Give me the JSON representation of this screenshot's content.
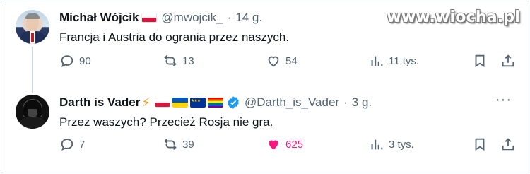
{
  "watermark": "www.wiocha.pl",
  "tweets": [
    {
      "name": "Michał Wójcik",
      "handle": "@mwojcik_",
      "separator": "·",
      "time": "14 g.",
      "text": "Francja i Austria do ograniа przez naszych.",
      "stats": {
        "replies": "90",
        "retweets": "13",
        "likes": "54",
        "views": "11 tys."
      },
      "liked": false
    },
    {
      "name": "Darth is Vader",
      "handle": "@Darth_is_Vader",
      "separator": "·",
      "time": "3 g.",
      "text": "Przez waszych? Przecież Rosja nie gra.",
      "stats": {
        "replies": "7",
        "retweets": "39",
        "likes": "625",
        "views": "3 tys."
      },
      "liked": true,
      "more": "···"
    }
  ],
  "colors": {
    "like_active": "#f91880",
    "verified": "#1d9bf0",
    "muted": "#536471"
  }
}
